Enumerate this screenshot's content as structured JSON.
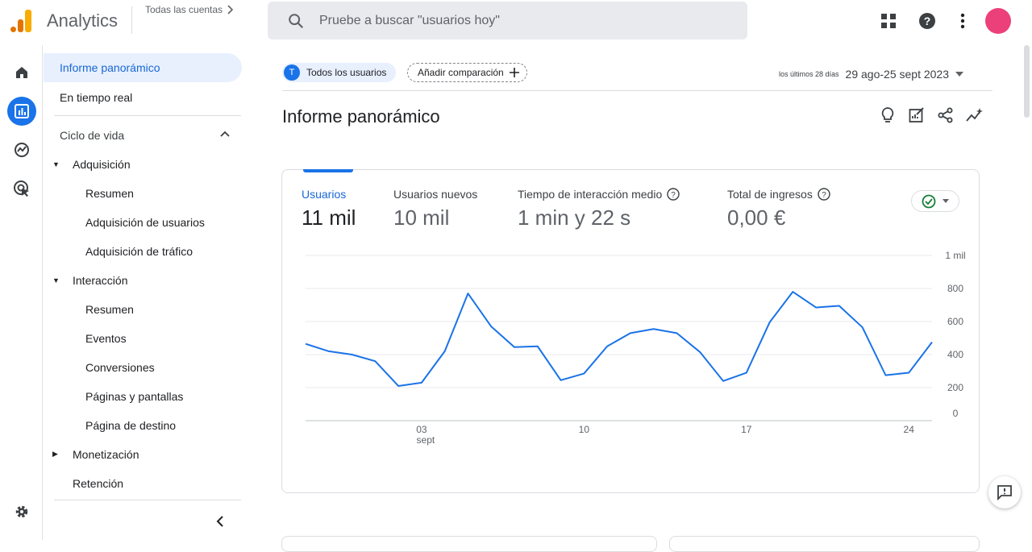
{
  "header": {
    "app_title": "Analytics",
    "accounts_link": "Todas las cuentas",
    "search_placeholder": "Pruebe a buscar \"usuarios hoy\"",
    "brand_colors": {
      "logo_dark": "#e37400",
      "logo_light": "#f9ab00",
      "avatar": "#ec407a"
    }
  },
  "rail": {
    "items": [
      {
        "icon": "home-icon"
      },
      {
        "icon": "reports-icon",
        "active": true
      },
      {
        "icon": "explore-icon"
      },
      {
        "icon": "advertising-icon"
      },
      {
        "icon": "settings-icon"
      }
    ]
  },
  "sidenav": {
    "active": "Informe panorámico",
    "realtime": "En tiempo real",
    "lifecycle": "Ciclo de vida",
    "acquisition": "Adquisición",
    "acq_summary": "Resumen",
    "acq_users": "Adquisición de usuarios",
    "acq_traffic": "Adquisición de tráfico",
    "engagement": "Interacción",
    "eng_summary": "Resumen",
    "eng_events": "Eventos",
    "eng_conversions": "Conversiones",
    "eng_pages": "Páginas y pantallas",
    "eng_landing": "Página de destino",
    "monetization": "Monetización",
    "retention": "Retención"
  },
  "main": {
    "segment_badge": "T",
    "segment_label": "Todos los usuarios",
    "add_comparison": "Añadir comparación",
    "date_small": "los últimos 28 días",
    "date_range": "29 ago-25 sept 2023",
    "page_title": "Informe panorámico"
  },
  "metrics": [
    {
      "label": "Usuarios",
      "value": "11 mil",
      "selected": true
    },
    {
      "label": "Usuarios nuevos",
      "value": "10 mil"
    },
    {
      "label": "Tiempo de interacción medio",
      "value": "1 min y 22 s"
    },
    {
      "label": "Total de ingresos",
      "value": "0,00 €"
    }
  ],
  "chart_data": {
    "type": "line",
    "x": [
      "29 ago",
      "30 ago",
      "31 ago",
      "1 sept",
      "2 sept",
      "3 sept",
      "4 sept",
      "5 sept",
      "6 sept",
      "7 sept",
      "8 sept",
      "9 sept",
      "10 sept",
      "11 sept",
      "12 sept",
      "13 sept",
      "14 sept",
      "15 sept",
      "16 sept",
      "17 sept",
      "18 sept",
      "19 sept",
      "20 sept",
      "21 sept",
      "22 sept",
      "23 sept",
      "24 sept",
      "25 sept"
    ],
    "series": [
      {
        "values": [
          465,
          420,
          400,
          360,
          210,
          230,
          420,
          770,
          570,
          445,
          450,
          245,
          285,
          450,
          530,
          555,
          530,
          415,
          240,
          290,
          595,
          780,
          685,
          695,
          565,
          275,
          290,
          475
        ],
        "color": "#1a73e8"
      }
    ],
    "ylim": [
      0,
      1000
    ],
    "y_ticks": [
      "0",
      "200",
      "400",
      "600",
      "800",
      "1 mil"
    ],
    "x_ticks": [
      {
        "index": 5,
        "label": "03",
        "sub": "sept"
      },
      {
        "index": 12,
        "label": "10",
        "sub": ""
      },
      {
        "index": 19,
        "label": "17",
        "sub": ""
      },
      {
        "index": 26,
        "label": "24",
        "sub": ""
      }
    ],
    "grid": true
  }
}
